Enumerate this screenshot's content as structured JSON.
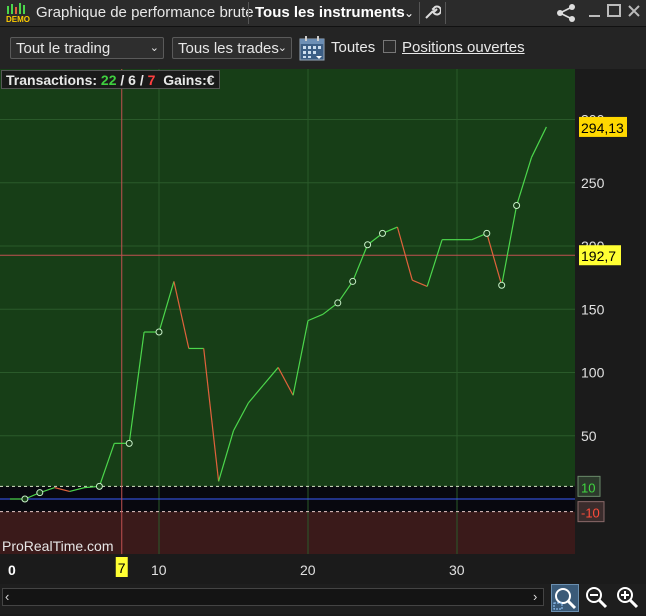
{
  "window": {
    "badge": "DEMO",
    "app_title": "Graphique de performance brute",
    "instrument_selector": "Tous les instruments",
    "icons": [
      "wrench-icon",
      "share-icon",
      "minimize-icon",
      "maximize-icon",
      "close-icon"
    ]
  },
  "toolbar": {
    "period_select": "Tout le trading",
    "trades_select": "Tous les trades",
    "calendar_icon": "calendar-icon",
    "all_label": "Toutes",
    "open_positions_label": "Positions ouvertes",
    "open_positions_checked": false
  },
  "stats": {
    "label": "Transactions:",
    "total": "22",
    "sep1": "/",
    "winners": "6",
    "sep2": "/",
    "losers": "7",
    "gains_label": "Gains:",
    "currency": "€"
  },
  "watermark": "ProRealTime.com",
  "colors": {
    "profit_zone": "#173e17",
    "loss_zone": "#3a1a1a",
    "up_segment": "#4cd64c",
    "down_segment": "#e0623c",
    "current_value_label": "#ffd800",
    "cursor_label": "#ffff33"
  },
  "chart_data": {
    "type": "line",
    "x": [
      0,
      1,
      2,
      3,
      4,
      5,
      6,
      7,
      8,
      9,
      10,
      11,
      12,
      13,
      14,
      15,
      16,
      17,
      18,
      19,
      20,
      21,
      22,
      23,
      24,
      25,
      26,
      27,
      28,
      29,
      30,
      31,
      32,
      33,
      34,
      35
    ],
    "y": [
      0,
      0,
      5,
      9,
      6,
      9,
      10,
      44,
      44,
      132,
      132,
      172,
      119,
      119,
      14,
      54,
      76,
      90,
      104,
      82,
      141,
      146,
      155,
      172,
      201,
      210,
      215,
      173,
      168,
      205,
      205,
      205,
      210,
      169,
      232,
      270,
      294.13
    ],
    "y_ticks": [
      "50",
      "100",
      "150",
      "200",
      "250",
      "300"
    ],
    "x_ticks": [
      "0",
      "10",
      "20",
      "30"
    ],
    "ylim": [
      -23,
      385
    ],
    "xlim": [
      0,
      38
    ],
    "last_value": "294,13",
    "cursor_value": "192,7",
    "cursor_x_label": "7",
    "upper_band": "10",
    "lower_band": "-10"
  }
}
